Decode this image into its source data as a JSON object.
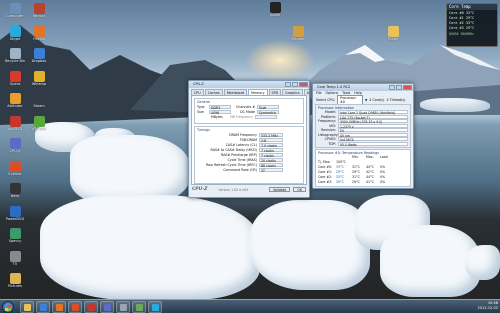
{
  "desktop_icons": [
    {
      "label": "Computer",
      "color": "#6a8fb8"
    },
    {
      "label": "Skype",
      "color": "#2aa9e0"
    },
    {
      "label": "Recycle Bin",
      "color": "#9fb3c6"
    },
    {
      "label": "Opera",
      "color": "#d83a2e"
    },
    {
      "label": "Atributor",
      "color": "#e6a12c"
    },
    {
      "label": "AnyDVD",
      "color": "#c4372c"
    },
    {
      "label": "CPU-Z",
      "color": "#5c6cc4"
    },
    {
      "label": "Everest",
      "color": "#d94f2b"
    },
    {
      "label": "Nero",
      "color": "#333333"
    },
    {
      "label": "PowerDVD",
      "color": "#2b6cc4"
    },
    {
      "label": "Speccy",
      "color": "#3c9a6c"
    },
    {
      "label": "TV",
      "color": "#8a8a8a"
    },
    {
      "label": "Pictures",
      "color": "#dcb45a"
    },
    {
      "label": "Recuva",
      "color": "#b8422e"
    },
    {
      "label": "Firefox",
      "color": "#e2742a"
    },
    {
      "label": "Dropbox",
      "color": "#3b7fd6"
    },
    {
      "label": "Winamp",
      "color": "#e2b12a"
    },
    {
      "label": "Steam",
      "color": "#333a45"
    },
    {
      "label": "uTorrent",
      "color": "#59a83a"
    }
  ],
  "top_icons": [
    {
      "label": "Apple",
      "color": "#222222"
    },
    {
      "label": "Mapper",
      "color": "#d0a040"
    },
    {
      "label": "Folder",
      "color": "#e8c25a"
    }
  ],
  "cpuz": {
    "title": "CPU-Z",
    "tabs": [
      "CPU",
      "Caches",
      "Mainboard",
      "Memory",
      "SPD",
      "Graphics",
      "About"
    ],
    "active_tab": "Memory",
    "general_title": "General",
    "type_label": "Type",
    "type_value": "DDR3",
    "size_label": "Size",
    "size_value": "4096 MBytes",
    "channels_label": "Channels #",
    "channels_value": "Dual",
    "dcmode_label": "DC Mode",
    "dcmode_value": "Symmetric",
    "nb_label": "NB Frequency",
    "timings_title": "Timings",
    "timings": [
      {
        "label": "DRAM Frequency",
        "value": "533.2 MHz"
      },
      {
        "label": "FSB:DRAM",
        "value": "2:8"
      },
      {
        "label": "CAS# Latency (CL)",
        "value": "7.0 clocks"
      },
      {
        "label": "RAS# to CAS# Delay (tRCD)",
        "value": "7 clocks"
      },
      {
        "label": "RAS# Precharge (tRP)",
        "value": "7 clocks"
      },
      {
        "label": "Cycle Time (tRAS)",
        "value": "20 clocks"
      },
      {
        "label": "Row Refresh Cycle Time (tRFC)",
        "value": "88 clocks"
      },
      {
        "label": "Command Rate (CR)",
        "value": "2T"
      }
    ],
    "brand": "CPU-Z",
    "version": "Version 1.62.0.x64",
    "validate_label": "Validate",
    "ok_label": "OK"
  },
  "coretemp": {
    "title": "Core Temp 1.0 RC2",
    "menu": [
      "File",
      "Options",
      "Tools",
      "Help"
    ],
    "select_label": "Select CPU:",
    "select_value": "Processor #0",
    "cores_text": "4 Core(s)",
    "threads_text": "4 Thread(s)",
    "info_title": "Processor Information",
    "info": [
      {
        "label": "Model:",
        "value": "Intel Core 2 Quad Q9650 (Yorkfield)"
      },
      {
        "label": "Platform:",
        "value": "LGA 775 (Socket T)"
      },
      {
        "label": "Frequency:",
        "value": "3000.00MHz (333.33 x 9.0)"
      },
      {
        "label": "VID:",
        "value": "1.2375 v"
      },
      {
        "label": "Revision:",
        "value": "E0"
      },
      {
        "label": "Lithography:",
        "value": "45 nm"
      },
      {
        "label": "CPUID:",
        "value": "0x1067A"
      },
      {
        "label": "TDP:",
        "value": "95.0 Watts"
      }
    ],
    "temps_title": "Processor #0: Temperature Readings",
    "temp_headers": [
      "",
      "Min.",
      "Max.",
      "Load"
    ],
    "tjmax": {
      "label": "Tj. Max:",
      "value": "100°C"
    },
    "temps": [
      {
        "label": "Core #0:",
        "cur": "33°C",
        "min": "31°C",
        "max": "44°C",
        "load": "0%"
      },
      {
        "label": "Core #1:",
        "cur": "29°C",
        "min": "29°C",
        "max": "42°C",
        "load": "0%"
      },
      {
        "label": "Core #2:",
        "cur": "33°C",
        "min": "31°C",
        "max": "44°C",
        "load": "0%"
      },
      {
        "label": "Core #3:",
        "cur": "29°C",
        "min": "29°C",
        "max": "41°C",
        "load": "0%"
      }
    ]
  },
  "gadget": {
    "title": "Core Temp",
    "lines": [
      "Core #0 33°C",
      "Core #1 29°C",
      "Core #2 33°C",
      "Core #3 29°C"
    ],
    "footer": "Q9650 3000MHz"
  },
  "taskbar": {
    "apps": [
      {
        "name": "explorer",
        "color": "#e8c25a"
      },
      {
        "name": "ie",
        "color": "#3b7fd6"
      },
      {
        "name": "media",
        "color": "#e2742a"
      },
      {
        "name": "firefox",
        "color": "#d94f2b"
      },
      {
        "name": "opera",
        "color": "#c4372c"
      },
      {
        "name": "cpuz",
        "color": "#5c6cc4"
      },
      {
        "name": "coretemp",
        "color": "#9aa4b0"
      },
      {
        "name": "paint",
        "color": "#6aa85a"
      },
      {
        "name": "skype",
        "color": "#2aa9e0"
      }
    ],
    "time": "10:48",
    "date": "2012-12-02"
  }
}
